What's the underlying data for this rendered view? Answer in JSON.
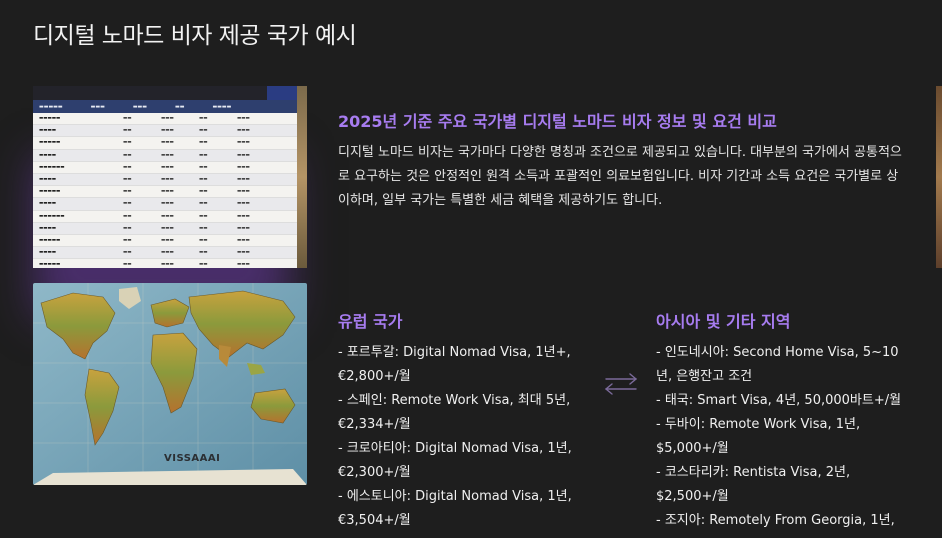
{
  "title": "디지털 노마드 비자 제공 국가 예시",
  "overview": {
    "subtitle": "2025년 기준 주요 국가별 디지털 노마드 비자 정보 및 요건 비교",
    "paragraph": "디지털 노마드 비자는 국가마다 다양한 명칭과 조건으로 제공되고 있습니다. 대부분의 국가에서 공통적으로 요구하는 것은 안정적인 원격 소득과 포괄적인 의료보험입니다. 비자 기간과 소득 요건은 국가별로 상이하며, 일부 국가는 특별한 세금 혜택을 제공하기도 합니다."
  },
  "map_image": {
    "label": "VISSAAAI"
  },
  "europe": {
    "title": "유럽 국가",
    "items": [
      "- 포르투갈: Digital Nomad Visa, 1년+, €2,800+/월",
      "- 스페인: Remote Work Visa, 최대 5년, €2,334+/월",
      "- 크로아티아: Digital Nomad Visa, 1년, €2,300+/월",
      "- 에스토니아: Digital Nomad Visa, 1년, €3,504+/월"
    ]
  },
  "asia": {
    "title": "아시아 및 기타 지역",
    "items": [
      "- 인도네시아: Second Home Visa, 5~10년, 은행잔고 조건",
      "- 태국: Smart Visa, 4년, 50,000바트+/월",
      "- 두바이: Remote Work Visa, 1년, $5,000+/월",
      "- 코스타리카: Rentista Visa, 2년, $2,500+/월",
      "- 조지아: Remotely From Georgia, 1년,"
    ]
  },
  "icons": {
    "swap": "swap-arrows-icon"
  },
  "colors": {
    "background": "#1e1e1e",
    "accent": "#a77cf0"
  }
}
